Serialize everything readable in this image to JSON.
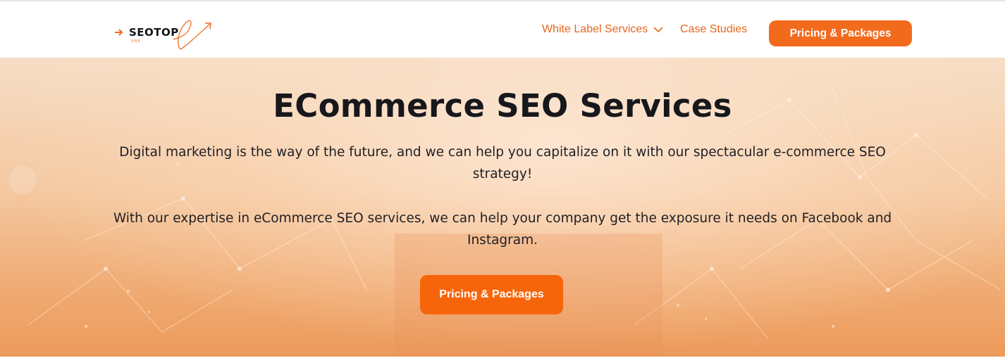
{
  "header": {
    "logo": {
      "name": "SEOTOP",
      "sub": "ONE"
    },
    "nav": {
      "white_label": "White Label Services",
      "case_studies": "Case Studies",
      "pricing_button": "Pricing & Packages"
    }
  },
  "hero": {
    "title": "ECommerce SEO Services",
    "paragraph_1": "Digital marketing is the way of the future, and we can help you capitalize on it with our spectacular e-commerce SEO strategy!",
    "paragraph_2": "With our expertise in eCommerce SEO services, we can help your company get the exposure it needs on Facebook and Instagram.",
    "cta_button": "Pricing & Packages"
  },
  "colors": {
    "accent": "#f26b1d",
    "text_dark": "#17171c",
    "hero_peach": "#f4c8a0"
  },
  "icons": [
    "logo-arrow-icon",
    "chevron-down-icon"
  ]
}
